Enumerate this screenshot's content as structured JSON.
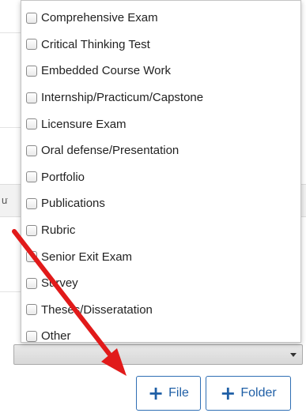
{
  "dropdown": {
    "options": [
      "Comprehensive Exam",
      "Critical Thinking Test",
      "Embedded Course Work",
      "Internship/Practicum/Capstone",
      "Licensure Exam",
      "Oral defense/Presentation",
      "Portfolio",
      "Publications",
      "Rubric",
      "Senior Exit Exam",
      "Survey",
      "Theses/Disseratation",
      "Other"
    ]
  },
  "background": {
    "clipped_text": "ut"
  },
  "buttons": {
    "file_label": "File",
    "folder_label": "Folder"
  },
  "colors": {
    "annotation_arrow": "#e11a1a",
    "button_accent": "#1f5fa6"
  }
}
